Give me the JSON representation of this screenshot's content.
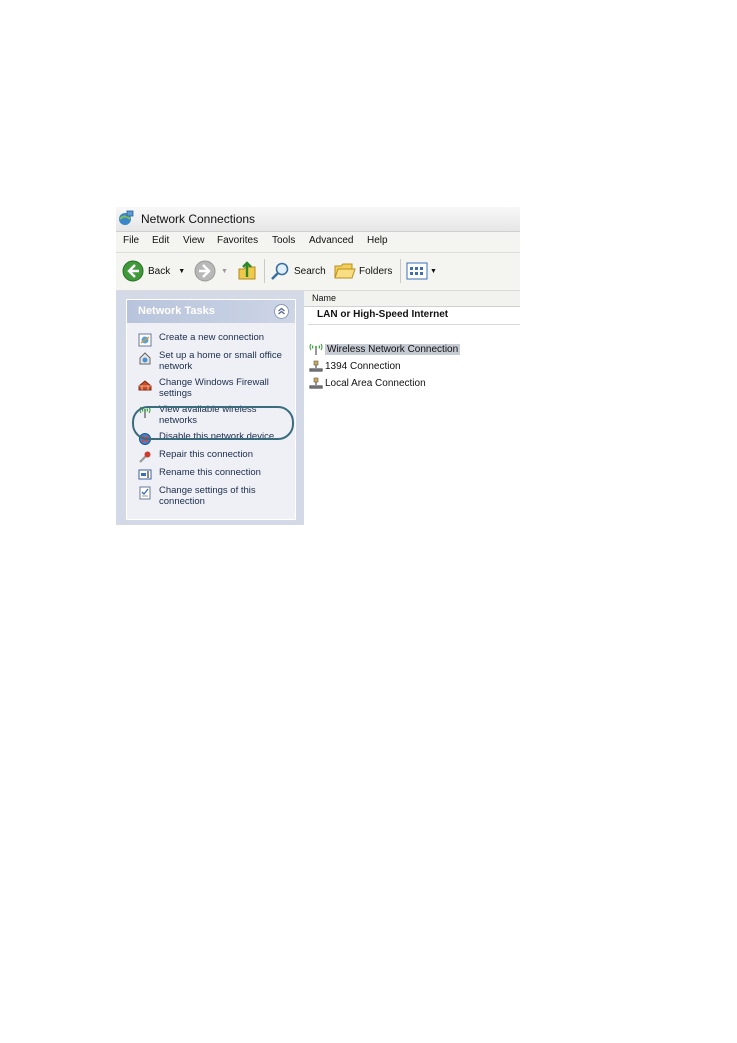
{
  "window": {
    "title": "Network Connections"
  },
  "menu": {
    "items": [
      "File",
      "Edit",
      "View",
      "Favorites",
      "Tools",
      "Advanced",
      "Help"
    ]
  },
  "toolbar": {
    "back_label": "Back",
    "search_label": "Search",
    "folders_label": "Folders"
  },
  "network_tasks": {
    "header": "Network Tasks",
    "items": [
      {
        "label": "Create a new connection",
        "icon": "new-connection-icon"
      },
      {
        "label": "Set up a home or small office network",
        "icon": "home-network-icon"
      },
      {
        "label": "Change Windows Firewall settings",
        "icon": "firewall-icon"
      },
      {
        "label": "View available wireless networks",
        "icon": "wireless-icon"
      },
      {
        "label": "Disable this network device",
        "icon": "disable-device-icon"
      },
      {
        "label": "Repair this connection",
        "icon": "repair-icon"
      },
      {
        "label": "Rename this connection",
        "icon": "rename-icon"
      },
      {
        "label": "Change settings of this connection",
        "icon": "settings-icon"
      }
    ]
  },
  "connections": {
    "column_header": "Name",
    "group": "LAN or High-Speed Internet",
    "items": [
      {
        "label": "Wireless Network Connection",
        "icon": "wireless-icon",
        "selected": true
      },
      {
        "label": "1394 Connection",
        "icon": "network-plug-icon",
        "selected": false
      },
      {
        "label": "Local Area Connection",
        "icon": "network-plug-icon",
        "selected": false
      }
    ]
  },
  "colors": {
    "task_pane_bg": "#d3d9e7",
    "task_text": "#20304e",
    "highlight_circle": "#3b6c7e",
    "selection": "#c7cbd4"
  }
}
